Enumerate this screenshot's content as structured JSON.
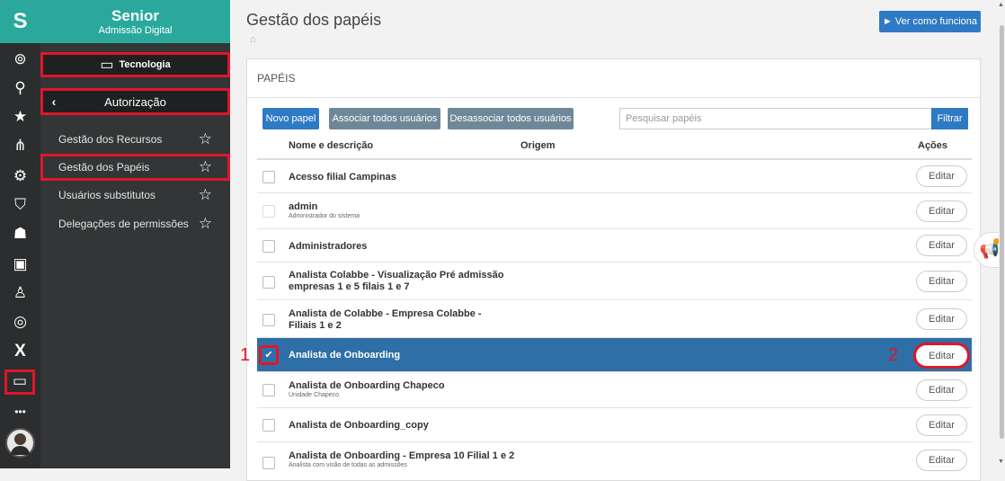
{
  "rail": {
    "logo": "S",
    "icons": [
      "user-circle-icon",
      "search-icon",
      "star-icon",
      "org-chart-icon",
      "building-gear-icon",
      "shield-icon",
      "people-icon",
      "briefcase-icon",
      "person-laptop-icon",
      "target-icon",
      "x-logo-icon",
      "monitor-icon",
      "more-icon",
      "avatar"
    ],
    "more_label": "•••"
  },
  "sidebar": {
    "brand_title": "Senior",
    "brand_sub": "Admissão Digital",
    "tech_label": "Tecnologia",
    "auth_label": "Autorização",
    "items": [
      {
        "label": "Gestão dos Recursos"
      },
      {
        "label": "Gestão dos Papéis"
      },
      {
        "label": "Usuários substitutos"
      },
      {
        "label": "Delegações de permissões"
      }
    ]
  },
  "header": {
    "title": "Gestão dos papéis",
    "ver_label": "► Ver como funciona"
  },
  "card": {
    "title": "PAPÉIS",
    "novo_label": "Novo papel",
    "associar_label": "Associar todos usuários",
    "desassociar_label": "Desassociar todos usuários",
    "search_placeholder": "Pesquisar papéis",
    "filtrar_label": "Filtrar",
    "columns": {
      "nome": "Nome e descrição",
      "origem": "Origem",
      "acoes": "Ações"
    },
    "edit_label": "Editar",
    "rows": [
      {
        "name": "Acesso filial Campinas",
        "desc": ""
      },
      {
        "name": "admin",
        "desc": "Administrador do sistema"
      },
      {
        "name": "Administradores",
        "desc": ""
      },
      {
        "name": "Analista Colabbe - Visualização Pré admissão empresas 1 e 5 filais 1 e 7",
        "desc": ""
      },
      {
        "name": "Analista de Colabbe - Empresa Colabbe - Filiais 1 e 2",
        "desc": ""
      },
      {
        "name": "Analista de Onboarding",
        "desc": "",
        "selected": true
      },
      {
        "name": "Analista de Onboarding Chapeco",
        "desc": "Unidade Chapeco"
      },
      {
        "name": "Analista de Onboarding_copy",
        "desc": ""
      },
      {
        "name": "Analista de Onboarding - Empresa 10 Filial 1 e 2",
        "desc": "Analista com visão de todas as admissões"
      }
    ]
  },
  "annotations": {
    "one": "1",
    "two": "2"
  }
}
